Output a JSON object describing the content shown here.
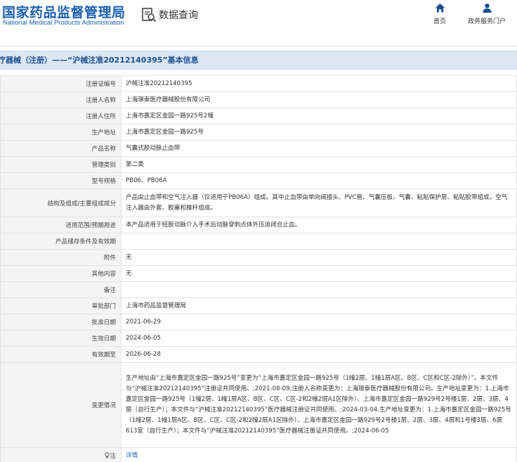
{
  "header": {
    "logo_cn": "国家药品监督管理局",
    "logo_en": "National Medical Products Administration",
    "query_label": "数据查询",
    "nav": [
      {
        "label": "首页",
        "icon": "home-icon"
      },
      {
        "label": "政务服务门户",
        "icon": "user-icon"
      }
    ]
  },
  "title": "疗器械（注册）——“沪械注准20212140395”基本信息",
  "rows": [
    {
      "label": "注册证编号",
      "value": "沪械注准20212140395"
    },
    {
      "label": "注册人名称",
      "value": "上海璟泰医疗器械股份有限公司"
    },
    {
      "label": "注册人住所",
      "value": "上海市嘉定区金园一路925号2幢"
    },
    {
      "label": "生产地址",
      "value": "上海市嘉定区金园一路925号"
    },
    {
      "label": "产品名称",
      "value": "气囊式股动脉止血带"
    },
    {
      "label": "管理类别",
      "value": "第二类"
    },
    {
      "label": "型号规格",
      "value": "PB06、PB06A"
    },
    {
      "label": "结构及组成/主要组成成分",
      "value": "产品由止血带和空气注入器（仅适用于PB06A）组成。其中止血带由单向阀接头、PVC管、气囊压板、气囊、粘贴保护层、粘贴胶带组成，空气注入器由外套、胶塞和推杆组成。"
    },
    {
      "label": "适用范围/预期用途",
      "value": "本产品适用于经股动脉介入手术后动脉穿刺点体外压迫闭合止血。"
    },
    {
      "label": "产品储存条件及有效期",
      "value": ""
    },
    {
      "label": "附件",
      "value": "无"
    },
    {
      "label": "其他内容",
      "value": "无"
    },
    {
      "label": "备注",
      "value": ""
    },
    {
      "label": "审批部门",
      "value": "上海市药品监督管理局"
    },
    {
      "label": "批准日期",
      "value": "2021-06-29"
    },
    {
      "label": "生效日期",
      "value": "2024-06-05"
    },
    {
      "label": "有效期至",
      "value": "2026-06-28"
    },
    {
      "label": "变更情况",
      "value": "生产地址由“上海市嘉定区金园一路925号”变更为“上海市嘉定区金园一路925号（1幢2层、1幢1层A区、B区、C区和C区-2除外）”。本文件与“沪械注准20212140395”注册证共同使用。;2021-08-09;注册人名称变更为：上海璟泰医疗器械股份有限公司。生产地址变更为：1.上海市嘉定区金园一路925号（1幢2层、1幢1层A区、B区、C区、C区-2和2幢2层A1区除外）、上海市嘉定区金园一路929号2号楼1层、2层、3层、4层（自行生产）；本文件与“沪械注准20212140395”医疗器械注册证共同使用。;2024-03-04.生产地址变更为：1.上海市嘉定区金园一路925号（1幢2层、1幢1层A区、B区、C区、C区-2和2幢2层A1区除外）、上海市嘉定区金园一路929号2号楼1层、2层、3层、4层和1号楼3层、6层613室（自行生产）；本文件与“沪械注准20212140395”医疗器械注册证共同使用。;2024-06-05"
    }
  ],
  "footer_row": {
    "label": "注",
    "icon": "lightbulb-icon",
    "link": "详情"
  }
}
